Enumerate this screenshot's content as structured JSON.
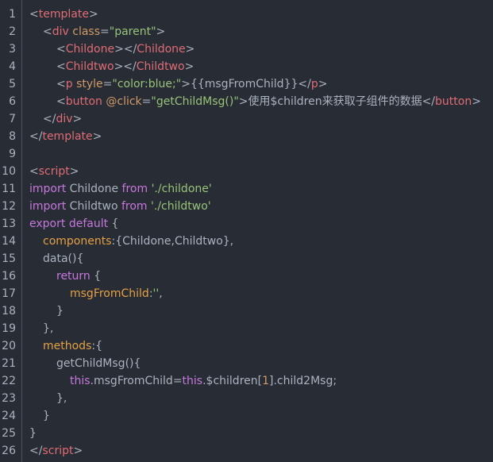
{
  "editor": {
    "lines": [
      {
        "n": "1",
        "indent": 0,
        "tokens": [
          {
            "t": "<",
            "c": "punct"
          },
          {
            "t": "template",
            "c": "tag"
          },
          {
            "t": ">",
            "c": "punct"
          }
        ]
      },
      {
        "n": "2",
        "indent": 1,
        "tokens": [
          {
            "t": "<",
            "c": "punct"
          },
          {
            "t": "div",
            "c": "tag"
          },
          {
            "t": " class",
            "c": "attr"
          },
          {
            "t": "=",
            "c": "punct"
          },
          {
            "t": "\"parent\"",
            "c": "str"
          },
          {
            "t": ">",
            "c": "punct"
          }
        ]
      },
      {
        "n": "3",
        "indent": 2,
        "tokens": [
          {
            "t": "<",
            "c": "punct"
          },
          {
            "t": "Childone",
            "c": "tag"
          },
          {
            "t": "></",
            "c": "punct"
          },
          {
            "t": "Childone",
            "c": "tag"
          },
          {
            "t": ">",
            "c": "punct"
          }
        ]
      },
      {
        "n": "4",
        "indent": 2,
        "tokens": [
          {
            "t": "<",
            "c": "punct"
          },
          {
            "t": "Childtwo",
            "c": "tag"
          },
          {
            "t": "></",
            "c": "punct"
          },
          {
            "t": "Childtwo",
            "c": "tag"
          },
          {
            "t": ">",
            "c": "punct"
          }
        ]
      },
      {
        "n": "5",
        "indent": 2,
        "tokens": [
          {
            "t": "<",
            "c": "punct"
          },
          {
            "t": "p",
            "c": "tag"
          },
          {
            "t": " style",
            "c": "attr"
          },
          {
            "t": "=",
            "c": "punct"
          },
          {
            "t": "\"color:blue;\"",
            "c": "str"
          },
          {
            "t": ">",
            "c": "punct"
          },
          {
            "t": "{{msgFromChild}}",
            "c": "text"
          },
          {
            "t": "</",
            "c": "punct"
          },
          {
            "t": "p",
            "c": "tag"
          },
          {
            "t": ">",
            "c": "punct"
          }
        ]
      },
      {
        "n": "6",
        "indent": 2,
        "tokens": [
          {
            "t": "<",
            "c": "punct"
          },
          {
            "t": "button",
            "c": "tag"
          },
          {
            "t": " @click",
            "c": "attr"
          },
          {
            "t": "=",
            "c": "punct"
          },
          {
            "t": "\"getChildMsg()\"",
            "c": "str"
          },
          {
            "t": ">",
            "c": "punct"
          },
          {
            "t": "使用$children来获取子组件的数据",
            "c": "text"
          },
          {
            "t": "</",
            "c": "punct"
          },
          {
            "t": "button",
            "c": "tag"
          },
          {
            "t": ">",
            "c": "punct"
          }
        ]
      },
      {
        "n": "7",
        "indent": 1,
        "tokens": [
          {
            "t": "</",
            "c": "punct"
          },
          {
            "t": "div",
            "c": "tag"
          },
          {
            "t": ">",
            "c": "punct"
          }
        ]
      },
      {
        "n": "8",
        "indent": 0,
        "tokens": [
          {
            "t": "</",
            "c": "punct"
          },
          {
            "t": "template",
            "c": "tag"
          },
          {
            "t": ">",
            "c": "punct"
          }
        ]
      },
      {
        "n": "9",
        "indent": 0,
        "tokens": []
      },
      {
        "n": "10",
        "indent": 0,
        "tokens": [
          {
            "t": "<",
            "c": "punct"
          },
          {
            "t": "script",
            "c": "tag"
          },
          {
            "t": ">",
            "c": "punct"
          }
        ]
      },
      {
        "n": "11",
        "indent": 0,
        "tokens": [
          {
            "t": "import",
            "c": "kw"
          },
          {
            "t": " Childone ",
            "c": "text"
          },
          {
            "t": "from",
            "c": "kw"
          },
          {
            "t": " ",
            "c": "text"
          },
          {
            "t": "'./childone'",
            "c": "str"
          }
        ]
      },
      {
        "n": "12",
        "indent": 0,
        "tokens": [
          {
            "t": "import",
            "c": "kw"
          },
          {
            "t": " Childtwo ",
            "c": "text"
          },
          {
            "t": "from",
            "c": "kw"
          },
          {
            "t": " ",
            "c": "text"
          },
          {
            "t": "'./childtwo'",
            "c": "str"
          }
        ]
      },
      {
        "n": "13",
        "indent": 0,
        "tokens": [
          {
            "t": "export",
            "c": "kw"
          },
          {
            "t": " ",
            "c": "text"
          },
          {
            "t": "default",
            "c": "kw"
          },
          {
            "t": " {",
            "c": "text"
          }
        ]
      },
      {
        "n": "14",
        "indent": 1,
        "tokens": [
          {
            "t": "components",
            "c": "prop"
          },
          {
            "t": ":{Childone,Childtwo},",
            "c": "text"
          }
        ]
      },
      {
        "n": "15",
        "indent": 1,
        "tokens": [
          {
            "t": "data(){",
            "c": "text"
          }
        ]
      },
      {
        "n": "16",
        "indent": 2,
        "tokens": [
          {
            "t": "return",
            "c": "kw"
          },
          {
            "t": " {",
            "c": "text"
          }
        ]
      },
      {
        "n": "17",
        "indent": 3,
        "tokens": [
          {
            "t": "msgFromChild",
            "c": "prop"
          },
          {
            "t": ":",
            "c": "text"
          },
          {
            "t": "''",
            "c": "str"
          },
          {
            "t": ",",
            "c": "text"
          }
        ]
      },
      {
        "n": "18",
        "indent": 2,
        "tokens": [
          {
            "t": "}",
            "c": "text"
          }
        ]
      },
      {
        "n": "19",
        "indent": 1,
        "tokens": [
          {
            "t": "},",
            "c": "text"
          }
        ]
      },
      {
        "n": "20",
        "indent": 1,
        "tokens": [
          {
            "t": "methods",
            "c": "prop"
          },
          {
            "t": ":{",
            "c": "text"
          }
        ]
      },
      {
        "n": "21",
        "indent": 2,
        "tokens": [
          {
            "t": "getChildMsg(){",
            "c": "text"
          }
        ]
      },
      {
        "n": "22",
        "indent": 3,
        "tokens": [
          {
            "t": "this",
            "c": "kw"
          },
          {
            "t": ".msgFromChild=",
            "c": "text"
          },
          {
            "t": "this",
            "c": "kw"
          },
          {
            "t": ".$children[",
            "c": "text"
          },
          {
            "t": "1",
            "c": "num"
          },
          {
            "t": "].child2Msg;",
            "c": "text"
          }
        ]
      },
      {
        "n": "23",
        "indent": 2,
        "tokens": [
          {
            "t": "},",
            "c": "text"
          }
        ]
      },
      {
        "n": "24",
        "indent": 1,
        "tokens": [
          {
            "t": "}",
            "c": "text"
          }
        ]
      },
      {
        "n": "25",
        "indent": 0,
        "tokens": [
          {
            "t": "}",
            "c": "text"
          }
        ]
      },
      {
        "n": "26",
        "indent": 0,
        "tokens": [
          {
            "t": "</",
            "c": "punct"
          },
          {
            "t": "script",
            "c": "tag"
          },
          {
            "t": ">",
            "c": "punct"
          }
        ]
      }
    ]
  },
  "colors": {
    "background": "#282c34",
    "gutter_border": "#4b5263",
    "tag": "#e06c75",
    "attribute": "#d19a66",
    "string": "#98c379",
    "keyword": "#c678dd",
    "property": "#e5a045",
    "text": "#abb2bf"
  }
}
